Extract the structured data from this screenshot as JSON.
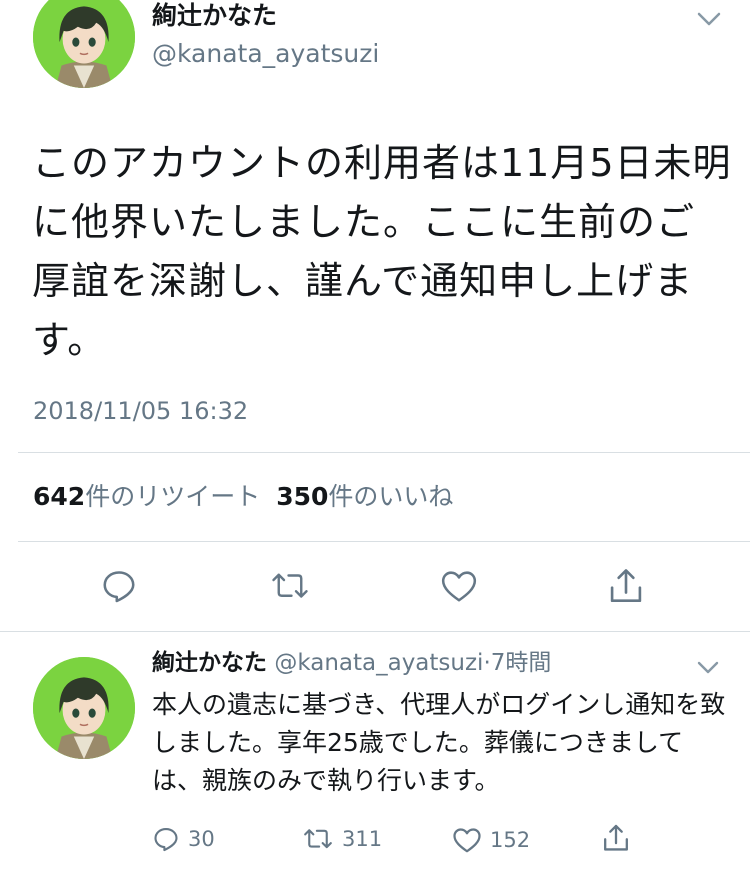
{
  "tweet": {
    "display_name": "絢辻かなた",
    "handle": "@kanata_ayatsuzi",
    "text": "このアカウントの利用者は11月5日未明に他界いたしました。ここに生前のご厚誼を深謝し、謹んで通知申し上げます。",
    "timestamp": "2018/11/05 16:32",
    "retweet_count": "642",
    "retweet_label": "件のリツイート",
    "like_count": "350",
    "like_label": "件のいいね",
    "icons": [
      "reply-icon",
      "retweet-icon",
      "like-icon",
      "share-icon",
      "chevron-down-icon"
    ]
  },
  "reply": {
    "display_name": "絢辻かなた",
    "handle": "@kanata_ayatsuzi",
    "separator": "·",
    "time_ago": "7時間",
    "text": "本人の遺志に基づき、代理人がログインし通知を致しました。享年25歳でした。葬儀につきましては、親族のみで執り行います。",
    "reply_count": "30",
    "retweet_count": "311",
    "like_count": "152"
  },
  "colors": {
    "text_primary": "#14171a",
    "text_secondary": "#657786",
    "divider": "#d9dfe3",
    "avatar_bg": "#7bd340"
  }
}
